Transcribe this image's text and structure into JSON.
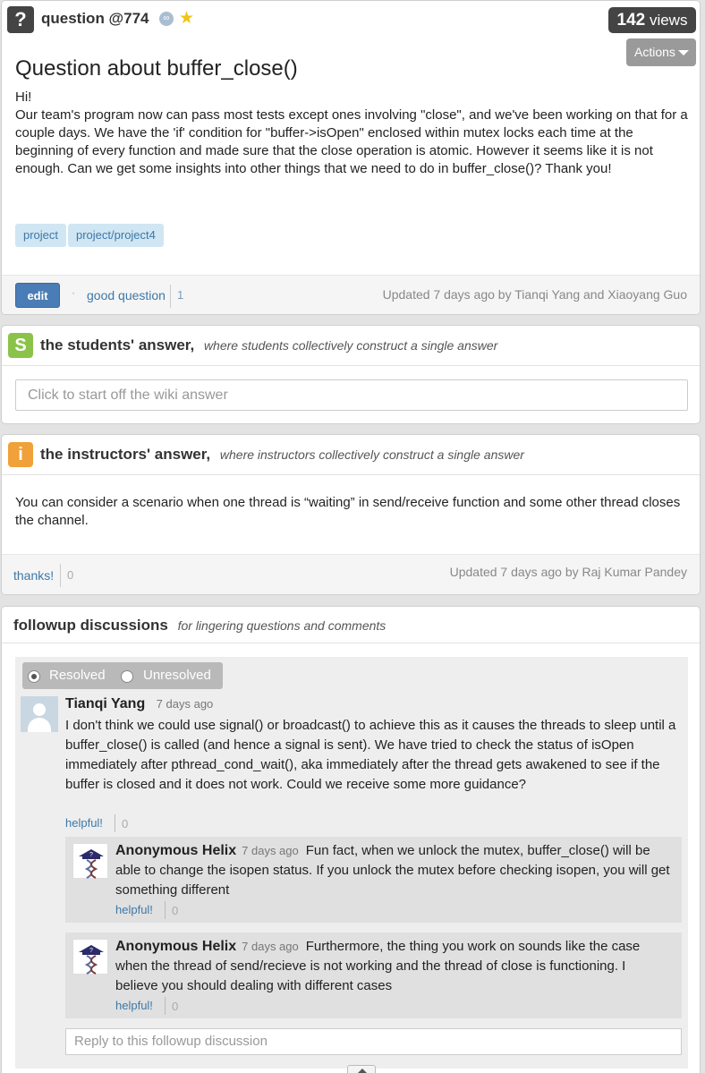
{
  "question": {
    "icon": "question-mark-icon",
    "icon_glyph": "?",
    "label": "question @774",
    "views_count": "142",
    "views_label": "views",
    "actions_label": "Actions",
    "title": "Question about buffer_close()",
    "body_greeting": "Hi!",
    "body": "Our team's program now can pass most tests except ones involving \"close\", and we've been working on that for a couple days. We have the 'if' condition for \"buffer->isOpen\" enclosed within mutex locks each time at the beginning of every function and made sure that the close operation is atomic. However it seems like it is not enough. Can we get some insights into other things that we need to do in buffer_close()? Thank you!",
    "tags": [
      "project",
      "project/project4"
    ],
    "edit_label": "edit",
    "good_question_label": "good question",
    "good_question_count": "1",
    "updated": "Updated 7 days ago by Tianqi Yang and Xiaoyang Guo"
  },
  "students_answer": {
    "icon_glyph": "S",
    "title": "the students' answer,",
    "subtitle": "where students collectively construct a single answer",
    "placeholder": "Click to start off the wiki answer",
    "accent_color": "#8bc34a"
  },
  "instructors_answer": {
    "icon_glyph": "i",
    "title": "the instructors' answer,",
    "subtitle": "where instructors collectively construct a single answer",
    "body": "You can consider a scenario when  one thread is “waiting” in send/receive function and some other thread closes the channel.",
    "thanks_label": "thanks!",
    "thanks_count": "0",
    "updated": "Updated 7 days ago by Raj Kumar Pandey",
    "accent_color": "#f0a139"
  },
  "followup": {
    "title": "followup discussions",
    "subtitle": "for lingering questions and comments",
    "resolved_label": "Resolved",
    "unresolved_label": "Unresolved",
    "resolved_selected": true,
    "post": {
      "author": "Tianqi Yang",
      "time": "7 days ago",
      "body": "I don't think we could use signal() or broadcast() to achieve this as it causes the threads to sleep until a buffer_close() is called (and hence a signal is sent). We have tried to check the status of isOpen immediately after pthread_cond_wait(), aka immediately after the thread gets awakened to see if the buffer is closed and it does not work. Could we receive some more guidance?",
      "helpful_label": "helpful!",
      "helpful_count": "0"
    },
    "replies": [
      {
        "author": "Anonymous Helix",
        "time": "7 days ago",
        "body": "Fun fact, when we unlock the mutex, buffer_close() will be able to change the isopen status. If you unlock the mutex before checking isopen, you will get something different",
        "helpful_label": "helpful!",
        "helpful_count": "0"
      },
      {
        "author": "Anonymous Helix",
        "time": "7 days ago",
        "body": "Furthermore, the thing you work on sounds like the case when the thread of send/recieve is not working and the thread of close is functioning. I believe you should dealing with different cases",
        "helpful_label": "helpful!",
        "helpful_count": "0"
      }
    ],
    "reply_placeholder": "Reply to this followup discussion"
  }
}
